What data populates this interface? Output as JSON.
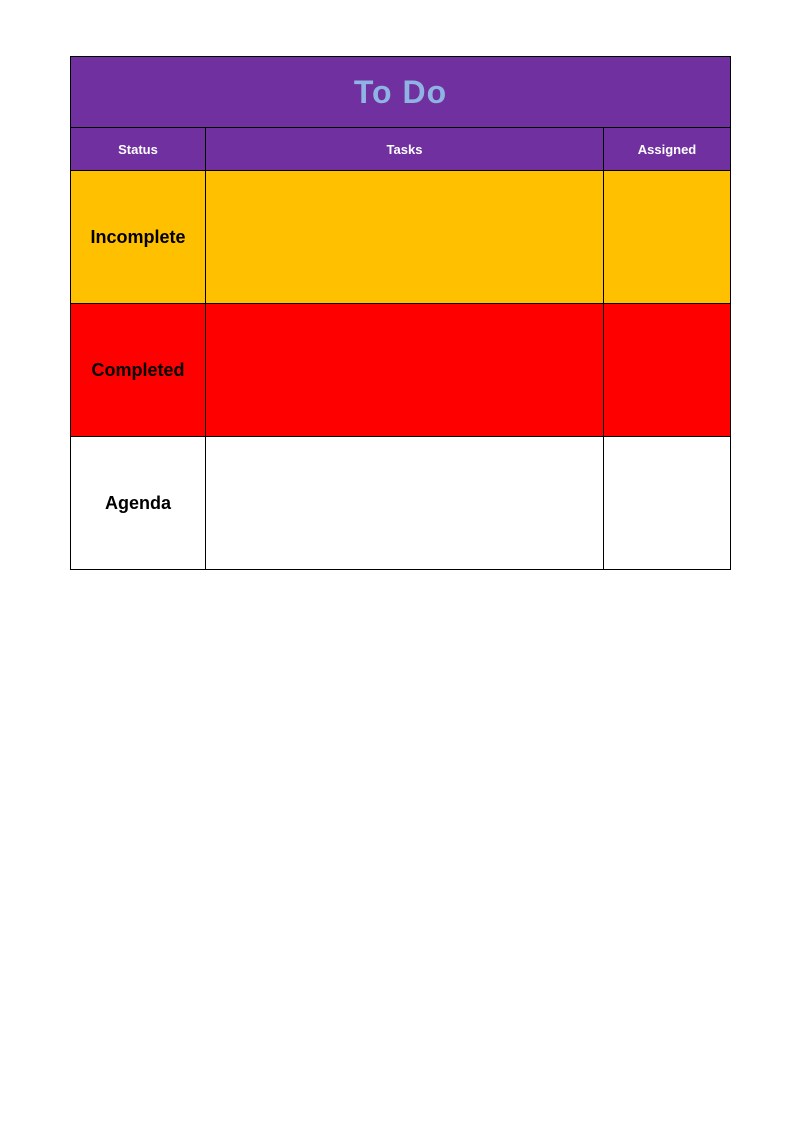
{
  "title": "To Do",
  "columns": {
    "status": "Status",
    "tasks": "Tasks",
    "assigned": "Assigned"
  },
  "rows": [
    {
      "status": "Incomplete",
      "tasks": "",
      "assigned": "",
      "color": "#ffc000"
    },
    {
      "status": "Completed",
      "tasks": "",
      "assigned": "",
      "color": "#ff0000"
    },
    {
      "status": "Agenda",
      "tasks": "",
      "assigned": "",
      "color": "#ffffff"
    }
  ]
}
